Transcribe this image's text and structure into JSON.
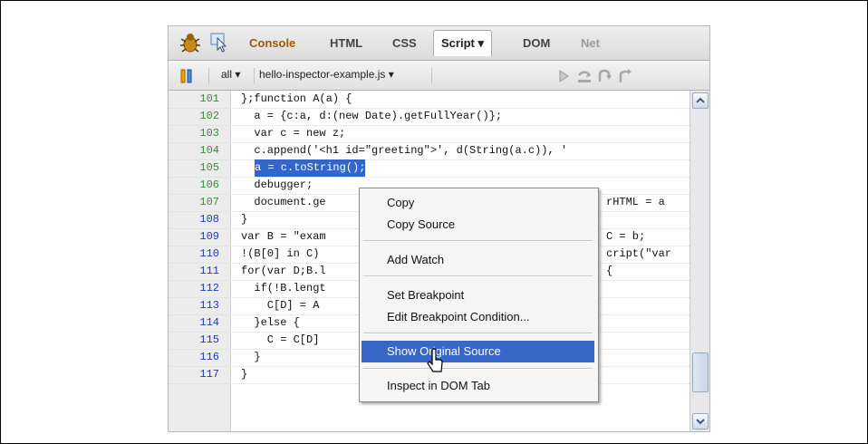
{
  "toolbar": {
    "tabs": [
      {
        "label": "Console"
      },
      {
        "label": "HTML"
      },
      {
        "label": "CSS"
      },
      {
        "label": "Script ▾"
      },
      {
        "label": "DOM"
      },
      {
        "label": "Net"
      }
    ],
    "filter": "all ▾",
    "file": "hello-inspector-example.js ▾"
  },
  "code": {
    "lines": [
      {
        "num": "101",
        "text": "};function A(a) {"
      },
      {
        "num": "102",
        "text": "  a = {c:a, d:(new Date).getFullYear()};"
      },
      {
        "num": "103",
        "text": "  var c = new z;"
      },
      {
        "num": "104",
        "text": "  c.append('<h1 id=\"greeting\">', d(String(a.c)), '"
      },
      {
        "num": "105",
        "text": "a = c.toString();"
      },
      {
        "num": "106",
        "text": "  debugger;"
      },
      {
        "num": "107",
        "text": "  document.ge"
      },
      {
        "num": "108",
        "text": "}"
      },
      {
        "num": "109",
        "text": "var B = \"exam"
      },
      {
        "num": "110",
        "text": "!(B[0] in C)"
      },
      {
        "num": "111",
        "text": "for(var D;B.l"
      },
      {
        "num": "112",
        "text": "  if(!B.lengt"
      },
      {
        "num": "113",
        "text": "    C[D] = A"
      },
      {
        "num": "114",
        "text": "  }else {"
      },
      {
        "num": "115",
        "text": "    C = C[D]"
      },
      {
        "num": "116",
        "text": "  }"
      },
      {
        "num": "117",
        "text": "}"
      }
    ],
    "right_fragments": {
      "r107": "rHTML = a",
      "r109": "C = b;",
      "r110": "cript(\"var",
      "r111": "{"
    }
  },
  "menu": {
    "items": [
      {
        "label": "Copy"
      },
      {
        "label": "Copy Source"
      },
      {
        "label": "Add Watch"
      },
      {
        "label": "Set Breakpoint"
      },
      {
        "label": "Edit Breakpoint Condition..."
      },
      {
        "label": "Show Original Source"
      },
      {
        "label": "Inspect in DOM Tab"
      }
    ]
  },
  "colors": {
    "highlight": "#3366cc",
    "menu_selected": "#3867c7",
    "line_number_green": "#3b8c3b",
    "line_number_blue": "#1b3fa9"
  },
  "icons": [
    "firebug-icon",
    "inspect-icon",
    "pause-icon",
    "continue-icon",
    "step-over-icon",
    "step-into-icon",
    "step-out-icon",
    "scroll-up-icon",
    "scroll-down-icon",
    "pointer-cursor-icon"
  ]
}
